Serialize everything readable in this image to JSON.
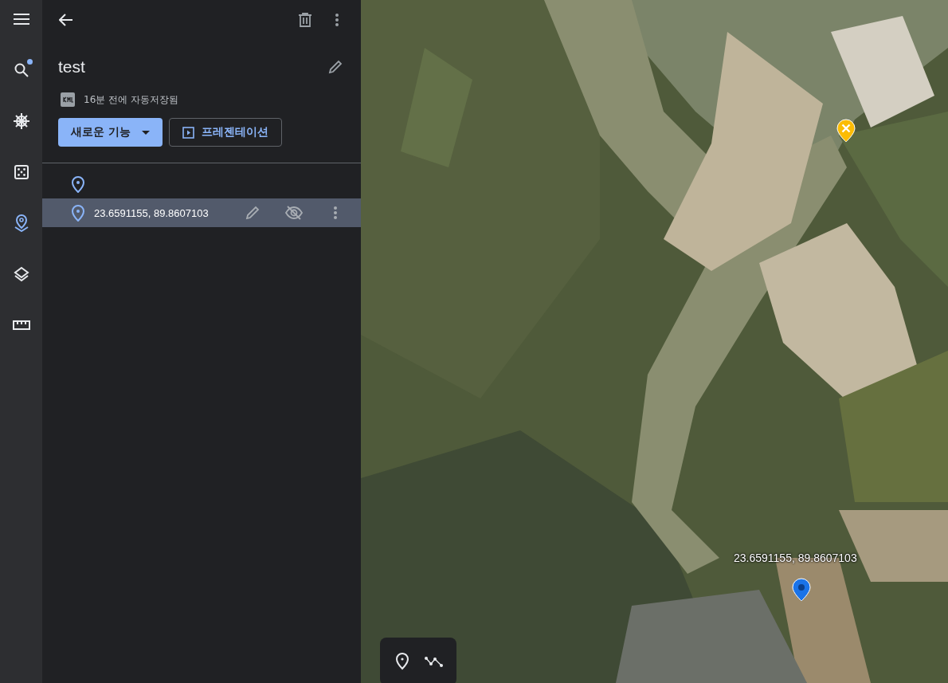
{
  "rail": [
    {
      "kind": "menu",
      "selected": false,
      "notify": false
    },
    {
      "kind": "search",
      "selected": false,
      "notify": true
    },
    {
      "kind": "voyager",
      "selected": false,
      "notify": false
    },
    {
      "kind": "dice",
      "selected": false,
      "notify": false
    },
    {
      "kind": "projects",
      "selected": true,
      "notify": false
    },
    {
      "kind": "layers",
      "selected": false,
      "notify": false
    },
    {
      "kind": "ruler",
      "selected": false,
      "notify": false
    }
  ],
  "project": {
    "title": "test",
    "saved": "16분 전에 자동저장됨",
    "new_feature_button": "새로운 기능",
    "presentation_button": "프레젠테이션"
  },
  "features": [
    {
      "selected": false
    },
    {
      "name": "23.6591155, 89.8607103",
      "selected": true
    }
  ],
  "map": {
    "placemark_label": "23.6591155, 89.8607103"
  }
}
